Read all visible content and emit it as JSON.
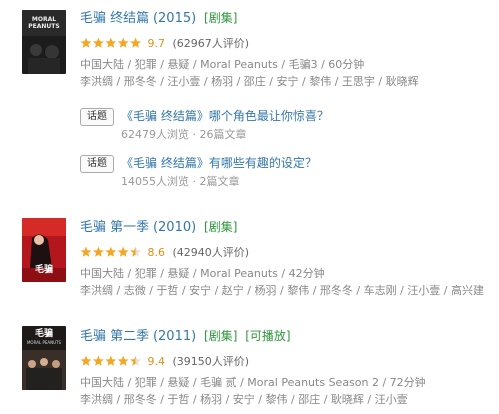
{
  "items": [
    {
      "title": "毛骗 终结篇",
      "year": "(2015)",
      "tags": [
        "[剧集]"
      ],
      "stars": 5.0,
      "score": "9.7",
      "count": "(62967人评价)",
      "meta1": "中国大陆 / 犯罪 / 悬疑 / Moral Peanuts / 毛骗3 / 60分钟",
      "meta2": "李洪绸 / 邢冬冬 / 汪小壹 / 杨羽 / 邵庄 / 安宁 / 黎伟 / 王思宇 / 耿晓辉",
      "poster_text": "MORAL PEANUTS",
      "topics": [
        {
          "button": "话题",
          "title": "《毛骗   终结篇》哪个角色最让你惊喜？",
          "meta": "62479人浏览 · 26篇文章"
        },
        {
          "button": "话题",
          "title": "《毛骗   终结篇》有哪些有趣的设定？",
          "meta": "14055人浏览 · 2篇文章"
        }
      ]
    },
    {
      "title": "毛骗 第一季",
      "year": "(2010)",
      "tags": [
        "[剧集]"
      ],
      "stars": 4.5,
      "score": "8.6",
      "count": "(42940人评价)",
      "meta1": "中国大陆 / 犯罪 / 悬疑 / Moral Peanuts / 42分钟",
      "meta2": "李洪绸 / 志微 / 于哲 / 安宁 / 赵宁 / 杨羽 / 黎伟 / 邢冬冬 / 车志刚 / 汪小壹 / 高兴建",
      "poster_text": "毛骗",
      "topics": []
    },
    {
      "title": "毛骗 第二季",
      "year": "(2011)",
      "tags": [
        "[剧集]",
        "[可播放]"
      ],
      "stars": 4.5,
      "score": "9.4",
      "count": "(39150人评价)",
      "meta1": "中国大陆 / 犯罪 / 悬疑 / 毛骗 贰 / Moral Peanuts Season 2 / 72分钟",
      "meta2": "李洪绸 / 邢冬冬 / 于哲 / 杨羽 / 安宁 / 黎伟 / 邵庄 / 耿晓辉 / 汪小壹",
      "poster_text": "毛骗",
      "poster_sub": "MORAL PEANUTS",
      "topics": []
    }
  ],
  "colors": {
    "link": "#3377aa",
    "green": "#2e963d",
    "star": "#f5a623",
    "score": "#e09015"
  }
}
